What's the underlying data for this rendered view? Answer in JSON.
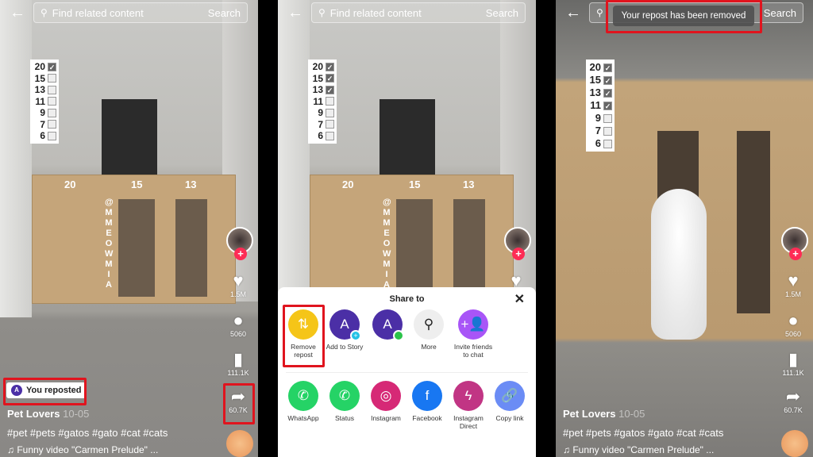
{
  "panels": [
    {
      "back": "←",
      "search_placeholder": "Find related content",
      "search_button": "Search",
      "checklist": [
        {
          "n": "20",
          "checked": true
        },
        {
          "n": "15",
          "checked": false
        },
        {
          "n": "13",
          "checked": false
        },
        {
          "n": "11",
          "checked": false
        },
        {
          "n": "9",
          "checked": false
        },
        {
          "n": "7",
          "checked": false
        },
        {
          "n": "6",
          "checked": false
        }
      ],
      "board_labels": [
        "20",
        "15",
        "13"
      ],
      "watermark": "@MMEOWMIA",
      "likes": "1.5M",
      "comments": "5060",
      "saves": "111.1K",
      "shares": "60.7K",
      "repost_badge": "You reposted",
      "repost_avatar": "A",
      "author": "Pet Lovers",
      "date": "10-05",
      "hashtags": "#pet #pets #gatos #gato #cat #cats",
      "music": "♫ Funny video \"Carmen Prelude\" ..."
    },
    {
      "back": "←",
      "search_placeholder": "Find related content",
      "search_button": "Search",
      "checklist": [
        {
          "n": "20",
          "checked": true
        },
        {
          "n": "15",
          "checked": true
        },
        {
          "n": "13",
          "checked": true
        },
        {
          "n": "11",
          "checked": false
        },
        {
          "n": "9",
          "checked": false
        },
        {
          "n": "7",
          "checked": false
        },
        {
          "n": "6",
          "checked": false
        }
      ],
      "board_labels": [
        "20",
        "15",
        "13"
      ],
      "watermark": "@MMEOWMIA",
      "share_sheet": {
        "title": "Share to",
        "close": "✕",
        "row1": [
          {
            "label": "Remove repost",
            "icon": "repost-icon",
            "color": "#f5c518",
            "glyph": "⇅"
          },
          {
            "label": "Add to Story",
            "icon": "avatar-add-icon",
            "color": "#4b2fa6",
            "glyph": "A"
          },
          {
            "label": "",
            "icon": "avatar-online-icon",
            "color": "#4b2fa6",
            "glyph": "A"
          },
          {
            "label": "More",
            "icon": "search-icon",
            "color": "#eeeeee",
            "glyph": "⚲"
          },
          {
            "label": "Invite friends to chat",
            "icon": "add-friend-icon",
            "color": "#a855f7",
            "glyph": "+👤"
          }
        ],
        "row2": [
          {
            "label": "WhatsApp",
            "icon": "whatsapp-icon",
            "color": "#25d366",
            "glyph": "✆"
          },
          {
            "label": "Status",
            "icon": "whatsapp-status-icon",
            "color": "#25d366",
            "glyph": "✆"
          },
          {
            "label": "Instagram",
            "icon": "instagram-icon",
            "color": "#d62976",
            "glyph": "◎"
          },
          {
            "label": "Facebook",
            "icon": "facebook-icon",
            "color": "#1877f2",
            "glyph": "f"
          },
          {
            "label": "Instagram Direct",
            "icon": "messenger-icon",
            "color": "#c13584",
            "glyph": "ϟ"
          },
          {
            "label": "Copy link",
            "icon": "link-icon",
            "color": "#6b8cf5",
            "glyph": "🔗"
          }
        ]
      }
    },
    {
      "back": "←",
      "search_button": "Search",
      "toast": "Your repost has been removed",
      "checklist": [
        {
          "n": "20",
          "checked": true
        },
        {
          "n": "15",
          "checked": true
        },
        {
          "n": "13",
          "checked": true
        },
        {
          "n": "11",
          "checked": true
        },
        {
          "n": "9",
          "checked": false
        },
        {
          "n": "7",
          "checked": false
        },
        {
          "n": "6",
          "checked": false
        }
      ],
      "likes": "1.5M",
      "comments": "5060",
      "saves": "111.1K",
      "shares": "60.7K",
      "author": "Pet Lovers",
      "date": "10-05",
      "hashtags": "#pet #pets #gatos #gato #cat #cats",
      "music": "♫ Funny video \"Carmen Prelude\" ..."
    }
  ],
  "highlight_color": "#e0141e"
}
